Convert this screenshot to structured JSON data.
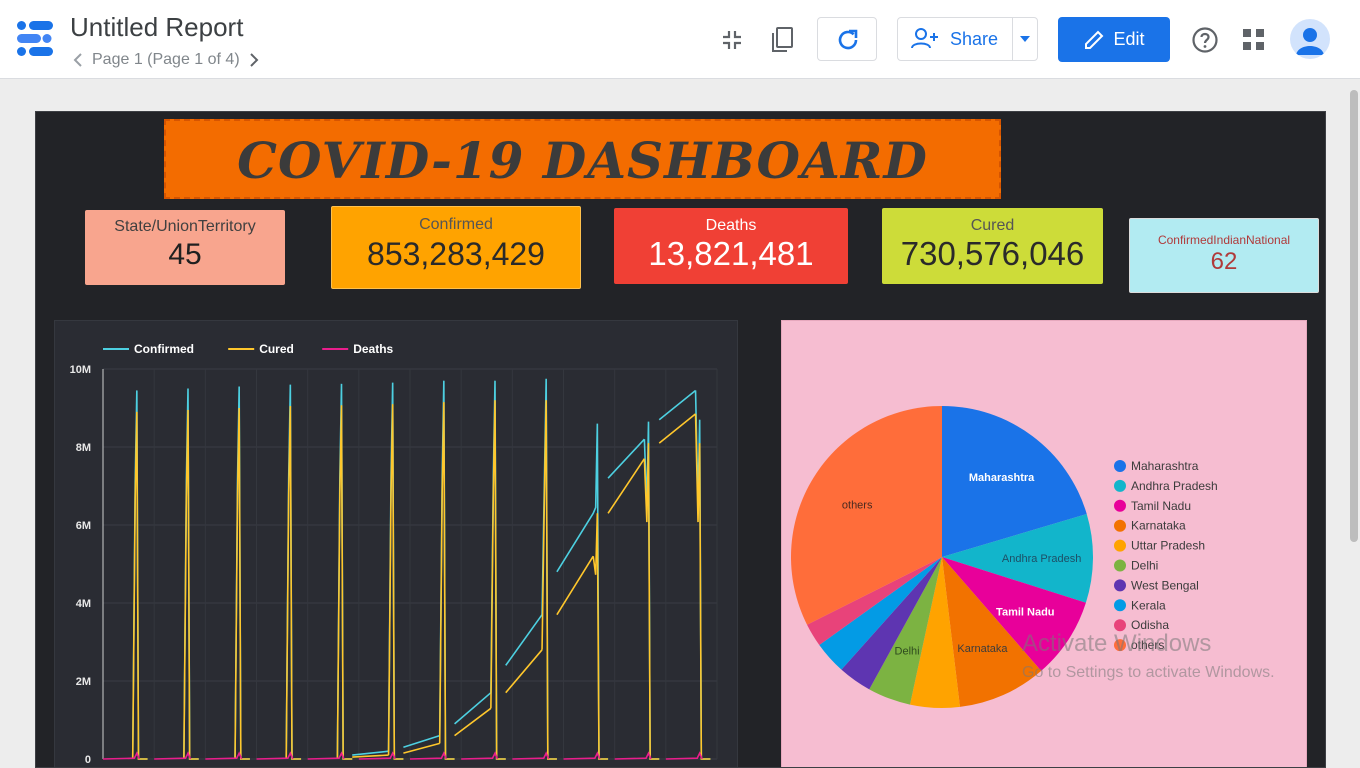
{
  "header": {
    "title": "Untitled Report",
    "page_label": "Page 1 (Page 1 of 4)",
    "share_label": "Share",
    "edit_label": "Edit"
  },
  "dashboard": {
    "banner": "COVID-19 DASHBOARD",
    "kpis": {
      "state": {
        "label": "State/UnionTerritory",
        "value": "45"
      },
      "confirmed": {
        "label": "Confirmed",
        "value": "853,283,429"
      },
      "deaths": {
        "label": "Deaths",
        "value": "13,821,481"
      },
      "cured": {
        "label": "Cured",
        "value": "730,576,046"
      },
      "indian_national": {
        "label": "ConfirmedIndianNational",
        "value": "62"
      }
    }
  },
  "watermark": {
    "line1": "Activate Windows",
    "line2": "Go to Settings to activate Windows."
  },
  "chart_data": [
    {
      "type": "line",
      "title": "",
      "ylim": [
        0,
        10000000
      ],
      "y_ticks": [
        "0",
        "2M",
        "4M",
        "6M",
        "8M",
        "10M"
      ],
      "y_tick_values": [
        0,
        2000000,
        4000000,
        6000000,
        8000000,
        10000000
      ],
      "grid": true,
      "legend_placement": "top-left",
      "colors": {
        "Confirmed": "#4dd0e1",
        "Cured": "#ffc72c",
        "Deaths": "#e91e8c"
      },
      "segments": [
        {
          "x0": 0.0,
          "peak_confirmed": 9450000,
          "peak_cured": 8900000,
          "peak_deaths": 150000
        },
        {
          "x0": 3.1,
          "peak_confirmed": 9500000,
          "peak_cured": 8950000,
          "peak_deaths": 150000
        },
        {
          "x0": 6.2,
          "peak_confirmed": 9550000,
          "peak_cured": 9000000,
          "peak_deaths": 150000
        },
        {
          "x0": 9.3,
          "peak_confirmed": 9600000,
          "peak_cured": 9050000,
          "peak_deaths": 150000
        },
        {
          "x0": 12.4,
          "peak_confirmed": 9620000,
          "peak_cured": 9070000,
          "peak_deaths": 150000
        },
        {
          "x0": 15.5,
          "start_confirmed": 100000,
          "end_confirmed": 200000,
          "start_cured": 50000,
          "end_cured": 100000,
          "peak_confirmed": 9650000,
          "peak_cured": 9100000,
          "peak_deaths": 150000
        },
        {
          "x0": 18.6,
          "start_confirmed": 300000,
          "end_confirmed": 600000,
          "start_cured": 150000,
          "end_cured": 400000,
          "peak_confirmed": 9700000,
          "peak_cured": 9150000,
          "peak_deaths": 150000
        },
        {
          "x0": 21.7,
          "start_confirmed": 900000,
          "end_confirmed": 1700000,
          "start_cured": 600000,
          "end_cured": 1300000,
          "peak_confirmed": 9700000,
          "peak_cured": 9200000,
          "peak_deaths": 150000
        },
        {
          "x0": 24.8,
          "start_confirmed": 2400000,
          "end_confirmed": 3700000,
          "start_cured": 1700000,
          "end_cured": 2800000,
          "peak_confirmed": 9750000,
          "peak_cured": 9200000,
          "peak_deaths": 150000
        },
        {
          "x0": 27.9,
          "start_confirmed": 4800000,
          "end_confirmed": 6300000,
          "start_cured": 3700000,
          "end_cured": 5200000,
          "peak_confirmed": 8600000,
          "peak_cured": 6300000,
          "peak_deaths": 150000
        },
        {
          "x0": 31.0,
          "start_confirmed": 7200000,
          "end_confirmed": 8200000,
          "start_cured": 6300000,
          "end_cured": 7700000,
          "peak_confirmed": 8650000,
          "peak_cured": 8100000,
          "peak_deaths": 150000
        },
        {
          "x0": 34.1,
          "start_confirmed": 8700000,
          "end_confirmed": 9450000,
          "start_cured": 8100000,
          "end_cured": 8850000,
          "peak_confirmed": 8700000,
          "peak_cured": 8100000,
          "peak_deaths": 150000
        }
      ],
      "series": [
        {
          "name": "Confirmed"
        },
        {
          "name": "Cured"
        },
        {
          "name": "Deaths"
        }
      ]
    },
    {
      "type": "pie",
      "title": "",
      "legend_placement": "right",
      "slices": [
        {
          "label": "Maharashtra",
          "value": 20.4,
          "color": "#1a73e8",
          "show_label": true,
          "label_color": "#ffffff"
        },
        {
          "label": "Andhra Pradesh",
          "value": 9.5,
          "color": "#12b5cb",
          "show_label": true,
          "label_color": "#1e4f66"
        },
        {
          "label": "Tamil Nadu",
          "value": 8.7,
          "color": "#e8009a",
          "show_label": true,
          "label_color": "#ffffff"
        },
        {
          "label": "Karnataka",
          "value": 9.5,
          "color": "#f27200",
          "show_label": true,
          "label_color": "#3c3c3c"
        },
        {
          "label": "Uttar Pradesh",
          "value": 5.3,
          "color": "#ffa300",
          "show_label": false,
          "label_color": "#3c3c3c"
        },
        {
          "label": "Delhi",
          "value": 4.6,
          "color": "#7cb342",
          "show_label": true,
          "label_color": "#2e4a1e"
        },
        {
          "label": "West Bengal",
          "value": 3.6,
          "color": "#5e35b1",
          "show_label": false,
          "label_color": "#ffffff"
        },
        {
          "label": "Kerala",
          "value": 3.5,
          "color": "#039be5",
          "show_label": false,
          "label_color": "#ffffff"
        },
        {
          "label": "Odisha",
          "value": 2.5,
          "color": "#e8437a",
          "show_label": false,
          "label_color": "#ffffff"
        },
        {
          "label": "others",
          "value": 32.4,
          "color": "#ff6d3a",
          "show_label": true,
          "label_color": "#4a2a20"
        }
      ]
    }
  ]
}
